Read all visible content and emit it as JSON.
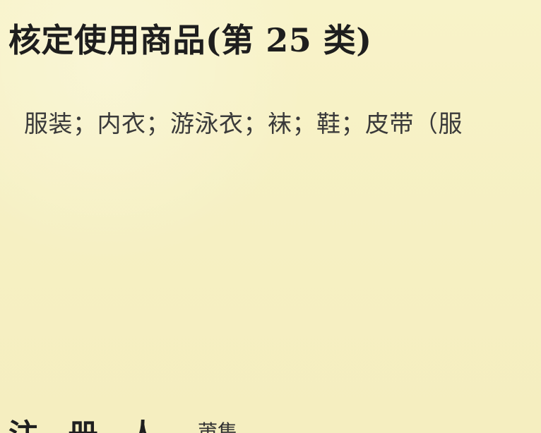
{
  "document": {
    "title": "核定使用商品(第 25 类)",
    "goods_line": "服装；内衣；游泳衣；袜；鞋；皮带（服",
    "footer_left": "注 册 人",
    "footer_right": "莆集"
  }
}
